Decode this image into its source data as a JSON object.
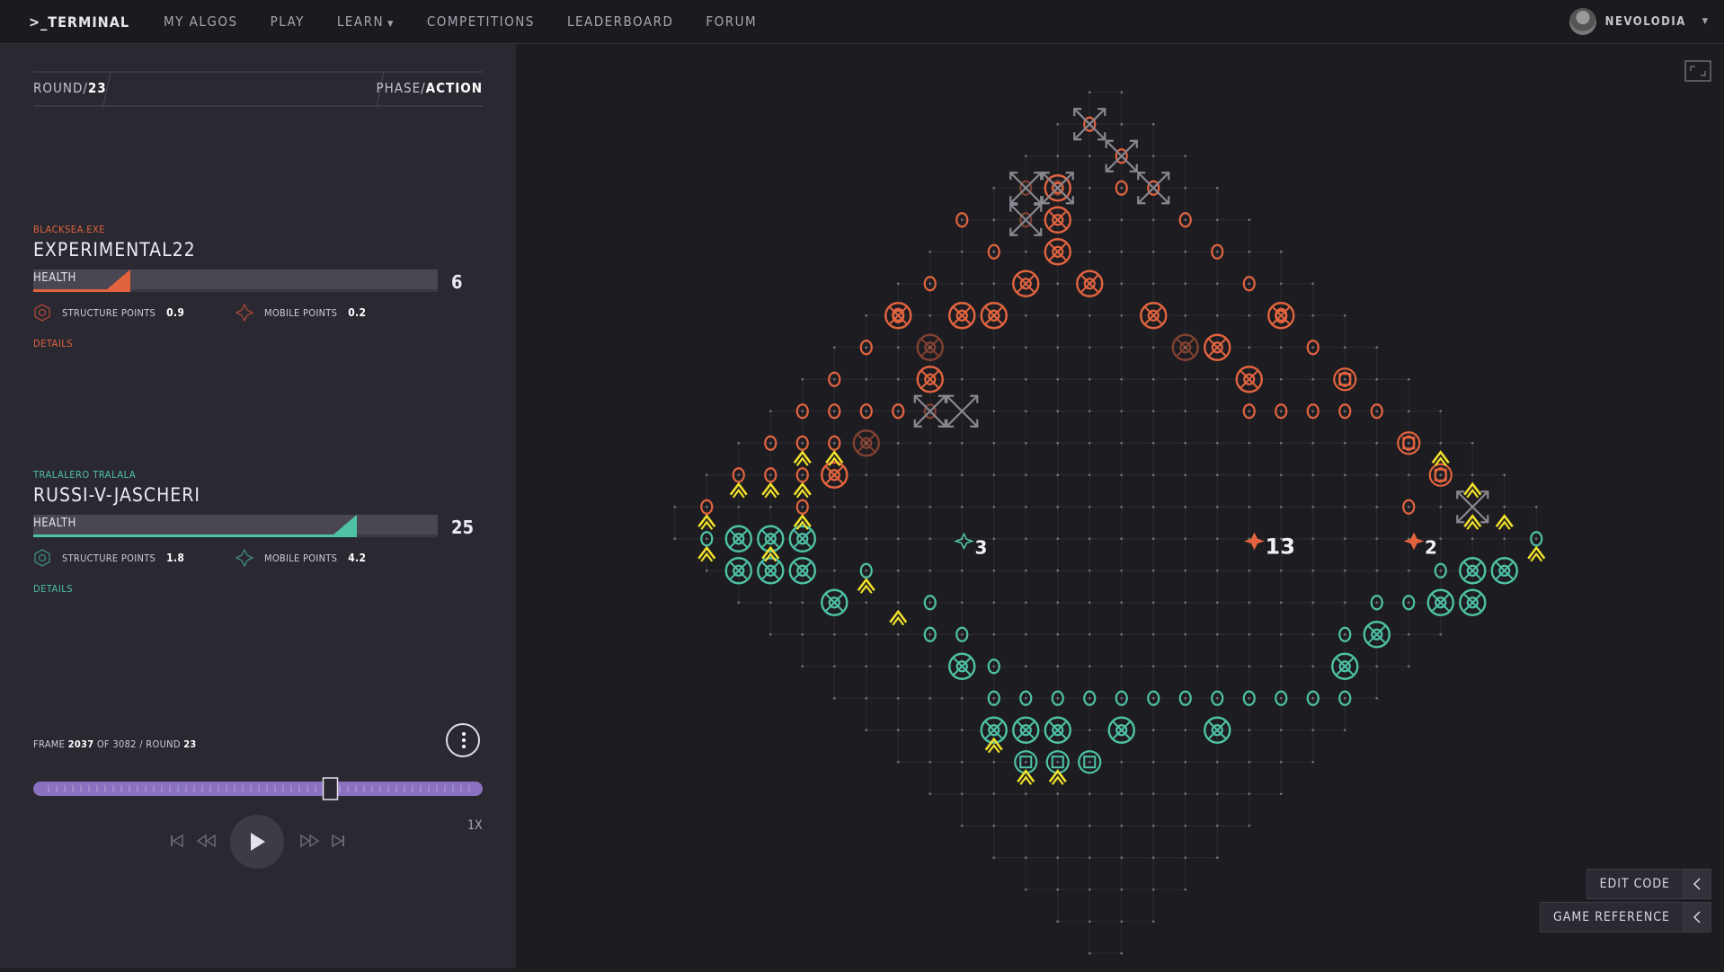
{
  "nav": {
    "brand": ">_TERMINAL",
    "items": [
      "MY ALGOS",
      "PLAY",
      "LEARN",
      "COMPETITIONS",
      "LEADERBOARD",
      "FORUM"
    ],
    "username": "NEVOLODIA"
  },
  "status": {
    "round_label": "ROUND/",
    "round_value": "23",
    "phase_label": "PHASE/",
    "phase_value": "ACTION"
  },
  "player1": {
    "algo": "BLACKSEA.EXE",
    "name": "EXPERIMENTAL22",
    "health_label": "HEALTH",
    "health": "6",
    "health_fraction": 0.24,
    "structure_label": "STRUCTURE POINTS",
    "structure_value": "0.9",
    "mobile_label": "MOBILE POINTS",
    "mobile_value": "0.2",
    "details": "DETAILS",
    "color": "#e2643f"
  },
  "player2": {
    "algo": "TRALALERO TRALALA",
    "name": "RUSSI-V-JASCHERI",
    "health_label": "HEALTH",
    "health": "25",
    "health_fraction": 0.8,
    "structure_label": "STRUCTURE POINTS",
    "structure_value": "1.8",
    "mobile_label": "MOBILE POINTS",
    "mobile_value": "4.2",
    "details": "DETAILS",
    "color": "#4fc2a5"
  },
  "replay": {
    "frame_label": "FRAME",
    "frame": "2037",
    "of_label": "OF",
    "total_frames": "3082",
    "round_label": "/ ROUND",
    "round": "23",
    "progress": 0.661,
    "speed": "1X"
  },
  "board": {
    "unit_counts": [
      {
        "label": "3",
        "owner": "player2"
      },
      {
        "label": "13",
        "owner": "player1"
      },
      {
        "label": "2",
        "owner": "player1"
      }
    ],
    "colors": {
      "red": "#e2643f",
      "teal": "#4fc2a5",
      "yellow": "#f1e12b",
      "removed": "#8a8790"
    }
  },
  "buttons": {
    "edit_code": "EDIT CODE",
    "game_reference": "GAME REFERENCE"
  },
  "icons": {
    "fullscreen": "fullscreen-icon",
    "play": "play-icon",
    "menu": "more-vertical-icon"
  }
}
